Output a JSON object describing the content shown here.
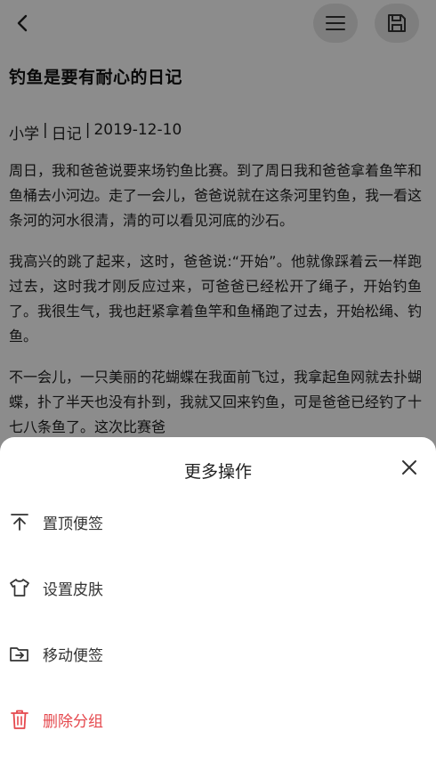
{
  "note": {
    "title": "钓鱼是要有耐心的日记",
    "meta": [
      "小学",
      "日记",
      "2019-12-10"
    ],
    "meta_separator": "|",
    "paragraphs": [
      "周日，我和爸爸说要来场钓鱼比赛。到了周日我和爸爸拿着鱼竿和鱼桶去小河边。走了一会儿，爸爸说就在这条河里钓鱼，我一看这条河的河水很清，清的可以看见河底的沙石。",
      "我高兴的跳了起来，这时，爸爸说:“开始”。他就像踩着云一样跑过去，这时我才刚反应过来，可爸爸已经松开了绳子，开始钓鱼了。我很生气，我也赶紧拿着鱼竿和鱼桶跑了过去，开始松绳、钓鱼。",
      "不一会儿，一只美丽的花蝴蝶在我面前飞过，我拿起鱼网就去扑蝴蝶，扑了半天也没有扑到，我就又回来钓鱼，可是爸爸已经钓了十七八条鱼了。这次比赛爸"
    ]
  },
  "sheet": {
    "title": "更多操作",
    "items": [
      {
        "icon": "pin-top-icon",
        "label": "置顶便签",
        "danger": false
      },
      {
        "icon": "shirt-icon",
        "label": "设置皮肤",
        "danger": false
      },
      {
        "icon": "folder-move-icon",
        "label": "移动便签",
        "danger": false
      },
      {
        "icon": "trash-icon",
        "label": "删除分组",
        "danger": true
      }
    ]
  },
  "colors": {
    "danger": "#e5484d",
    "overlay": "rgba(0,0,0,0.45)",
    "button_bg": "#e6e6e6"
  }
}
